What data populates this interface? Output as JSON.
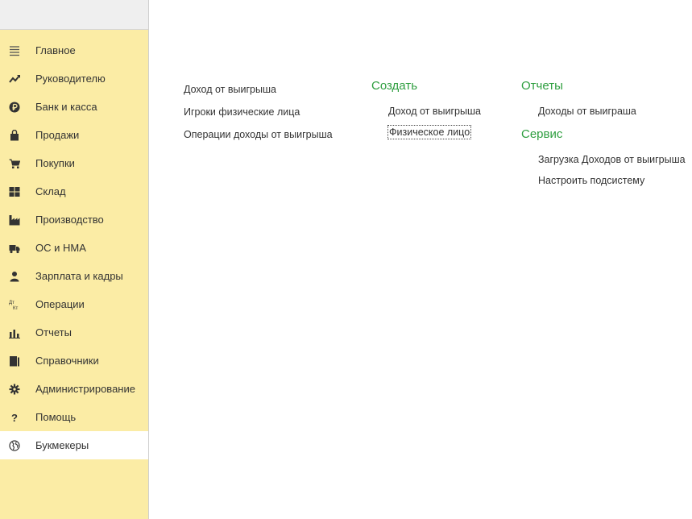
{
  "sidebar": {
    "items": [
      {
        "label": "Главное",
        "icon": "menu-lines-icon",
        "active": false
      },
      {
        "label": "Руководителю",
        "icon": "trend-icon",
        "active": false
      },
      {
        "label": "Банк и касса",
        "icon": "ruble-icon",
        "active": false
      },
      {
        "label": "Продажи",
        "icon": "shopping-bag-icon",
        "active": false
      },
      {
        "label": "Покупки",
        "icon": "cart-icon",
        "active": false
      },
      {
        "label": "Склад",
        "icon": "warehouse-icon",
        "active": false
      },
      {
        "label": "Производство",
        "icon": "factory-icon",
        "active": false
      },
      {
        "label": "ОС и НМА",
        "icon": "truck-icon",
        "active": false
      },
      {
        "label": "Зарплата и кадры",
        "icon": "person-icon",
        "active": false
      },
      {
        "label": "Операции",
        "icon": "dt-kt-icon",
        "icon_text": "Дт\nКт",
        "active": false
      },
      {
        "label": "Отчеты",
        "icon": "bar-chart-icon",
        "active": false
      },
      {
        "label": "Справочники",
        "icon": "books-icon",
        "active": false
      },
      {
        "label": "Администрирование",
        "icon": "gear-icon",
        "active": false
      },
      {
        "label": "Помощь",
        "icon": "question-icon",
        "active": false
      },
      {
        "label": "Букмекеры",
        "icon": "globe-icon",
        "active": true
      }
    ]
  },
  "main": {
    "links": [
      "Доход от выигрыша",
      "Игроки физические лица",
      "Операции доходы от выигрыша"
    ],
    "create": {
      "title": "Создать",
      "items": [
        "Доход от выигрыша",
        "Физическое лицо"
      ]
    },
    "reports": {
      "title": "Отчеты",
      "items": [
        "Доходы от выиграша"
      ]
    },
    "service": {
      "title": "Сервис",
      "items": [
        "Загрузка Доходов от выигрыша",
        "Настроить подсистему"
      ]
    }
  },
  "colors": {
    "sidebar_bg": "#fbeca5",
    "section_title": "#2e9e3f",
    "active_item_bg": "#ffffff"
  }
}
